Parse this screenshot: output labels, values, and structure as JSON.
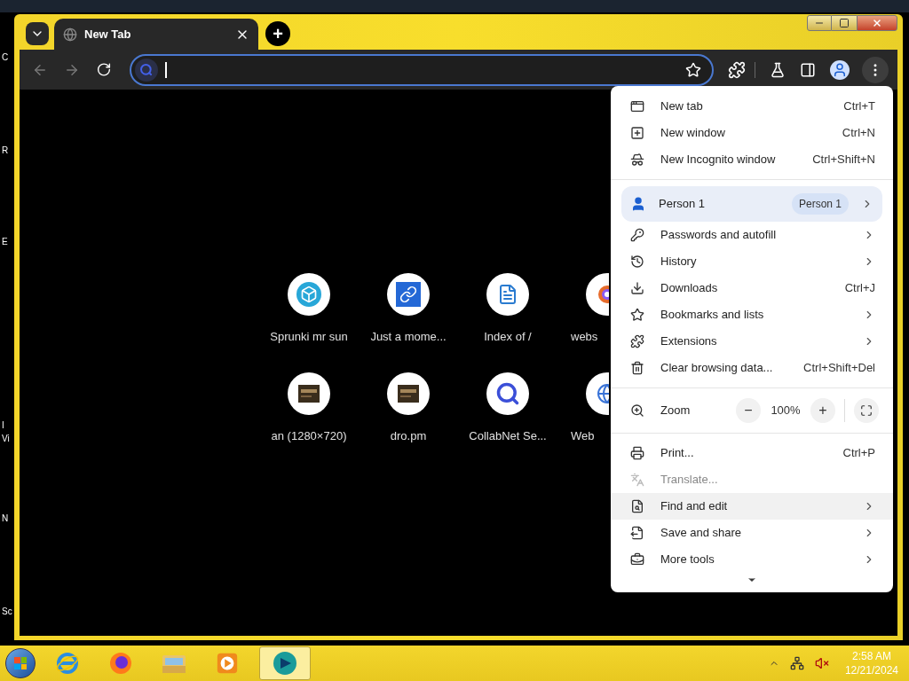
{
  "desktop_labels": [
    "C",
    "R",
    "E",
    "I",
    "Vi",
    "N",
    "Sc"
  ],
  "tabs": [
    {
      "title": "New Tab",
      "selected": true
    }
  ],
  "new_tab_button": "+",
  "shortcuts": [
    {
      "label": "Sprunki mr sun"
    },
    {
      "label": "Just a mome..."
    },
    {
      "label": "Index of /"
    },
    {
      "label": "webs"
    },
    {
      "label": "an (1280×720)"
    },
    {
      "label": "dro.pm"
    },
    {
      "label": "CollabNet Se..."
    },
    {
      "label": "Web"
    }
  ],
  "menu": [
    {
      "kind": "item",
      "label": "New tab",
      "shortcut": "Ctrl+T",
      "submenu": false,
      "disabled": false,
      "highlighted": false
    },
    {
      "kind": "item",
      "label": "New window",
      "shortcut": "Ctrl+N",
      "submenu": false,
      "disabled": false,
      "highlighted": false
    },
    {
      "kind": "item",
      "label": "New Incognito window",
      "shortcut": "Ctrl+Shift+N",
      "submenu": false,
      "disabled": false,
      "highlighted": false
    },
    {
      "kind": "divider"
    },
    {
      "kind": "profile",
      "label": "Person 1",
      "badge": "Person 1"
    },
    {
      "kind": "item",
      "label": "Passwords and autofill",
      "submenu": true,
      "disabled": false,
      "highlighted": false
    },
    {
      "kind": "item",
      "label": "History",
      "submenu": true,
      "disabled": false,
      "highlighted": false
    },
    {
      "kind": "item",
      "label": "Downloads",
      "shortcut": "Ctrl+J",
      "submenu": false,
      "disabled": false,
      "highlighted": false
    },
    {
      "kind": "item",
      "label": "Bookmarks and lists",
      "submenu": true,
      "disabled": false,
      "highlighted": false
    },
    {
      "kind": "item",
      "label": "Extensions",
      "submenu": true,
      "disabled": false,
      "highlighted": false
    },
    {
      "kind": "item",
      "label": "Clear browsing data...",
      "shortcut": "Ctrl+Shift+Del",
      "submenu": false,
      "disabled": false,
      "highlighted": false
    },
    {
      "kind": "divider"
    },
    {
      "kind": "zoom",
      "label": "Zoom",
      "minus": "−",
      "value": "100%",
      "plus": "+"
    },
    {
      "kind": "divider"
    },
    {
      "kind": "item",
      "label": "Print...",
      "shortcut": "Ctrl+P",
      "submenu": false,
      "disabled": false,
      "highlighted": false
    },
    {
      "kind": "item",
      "label": "Translate...",
      "submenu": false,
      "disabled": true,
      "highlighted": false
    },
    {
      "kind": "item",
      "label": "Find and edit",
      "submenu": true,
      "disabled": false,
      "highlighted": true
    },
    {
      "kind": "item",
      "label": "Save and share",
      "submenu": true,
      "disabled": false,
      "highlighted": false
    },
    {
      "kind": "item",
      "label": "More tools",
      "submenu": true,
      "disabled": false,
      "highlighted": false
    },
    {
      "kind": "more"
    }
  ],
  "taskbar": {
    "apps": [
      {
        "selected": false
      },
      {
        "selected": false
      },
      {
        "selected": false
      },
      {
        "selected": false
      },
      {
        "selected": true
      }
    ],
    "time": "2:58 AM",
    "date": "12/21/2024"
  }
}
